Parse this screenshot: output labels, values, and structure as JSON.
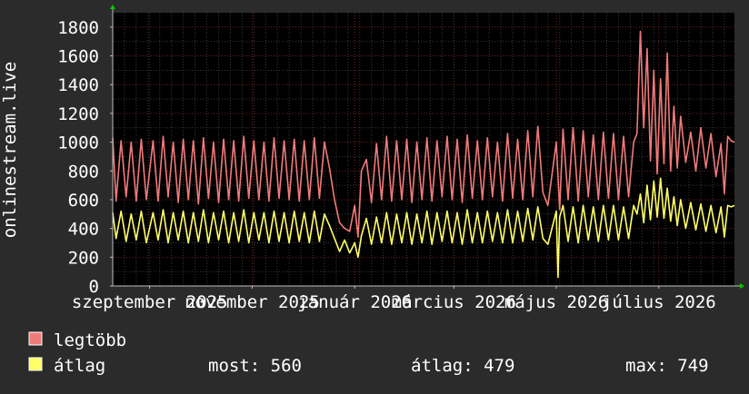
{
  "colors": {
    "background": "#2b2b2b",
    "plot_background": "#000000",
    "grid_minor": "#3a3a3a",
    "grid_major": "#6b2020",
    "axis": "#bfbfbf",
    "arrow": "#00cc00",
    "text": "#ffffff",
    "max_series": "#f07a7a",
    "avg_series": "#ffff66"
  },
  "chart_data": {
    "type": "line",
    "ylabel": "onlinestream.live",
    "ylim": [
      0,
      1900
    ],
    "yticks": [
      0,
      200,
      400,
      600,
      800,
      1000,
      1200,
      1400,
      1600,
      1800
    ],
    "xlim": [
      "2025-08-10",
      "2026-08-15"
    ],
    "xticks": [
      {
        "date": "2025-09-01",
        "label": "szeptember 2025"
      },
      {
        "date": "2025-11-01",
        "label": "november 2025"
      },
      {
        "date": "2026-01-01",
        "label": "január 2026"
      },
      {
        "date": "2026-03-01",
        "label": "március 2026"
      },
      {
        "date": "2026-05-01",
        "label": "május 2026"
      },
      {
        "date": "2026-07-01",
        "label": "július 2026"
      }
    ],
    "grid": true,
    "series": [
      {
        "name": "legtöbb",
        "color": "#f07a7a",
        "points": [
          [
            "2025-08-10",
            1030
          ],
          [
            "2025-08-12",
            590
          ],
          [
            "2025-08-15",
            1010
          ],
          [
            "2025-08-18",
            620
          ],
          [
            "2025-08-21",
            1000
          ],
          [
            "2025-08-24",
            590
          ],
          [
            "2025-08-27",
            1020
          ],
          [
            "2025-08-30",
            600
          ],
          [
            "2025-09-03",
            1010
          ],
          [
            "2025-09-06",
            590
          ],
          [
            "2025-09-09",
            1040
          ],
          [
            "2025-09-12",
            620
          ],
          [
            "2025-09-15",
            1000
          ],
          [
            "2025-09-18",
            580
          ],
          [
            "2025-09-21",
            1020
          ],
          [
            "2025-09-24",
            600
          ],
          [
            "2025-09-27",
            1010
          ],
          [
            "2025-09-30",
            570
          ],
          [
            "2025-10-03",
            1030
          ],
          [
            "2025-10-06",
            610
          ],
          [
            "2025-10-09",
            1000
          ],
          [
            "2025-10-12",
            580
          ],
          [
            "2025-10-15",
            1020
          ],
          [
            "2025-10-18",
            600
          ],
          [
            "2025-10-21",
            1010
          ],
          [
            "2025-10-24",
            590
          ],
          [
            "2025-10-27",
            1040
          ],
          [
            "2025-10-30",
            610
          ],
          [
            "2025-11-02",
            1010
          ],
          [
            "2025-11-05",
            600
          ],
          [
            "2025-11-08",
            1000
          ],
          [
            "2025-11-11",
            590
          ],
          [
            "2025-11-14",
            1030
          ],
          [
            "2025-11-17",
            610
          ],
          [
            "2025-11-20",
            1010
          ],
          [
            "2025-11-23",
            600
          ],
          [
            "2025-11-26",
            1020
          ],
          [
            "2025-11-29",
            590
          ],
          [
            "2025-12-02",
            1010
          ],
          [
            "2025-12-05",
            600
          ],
          [
            "2025-12-08",
            1030
          ],
          [
            "2025-12-11",
            610
          ],
          [
            "2025-12-14",
            1000
          ],
          [
            "2025-12-17",
            820
          ],
          [
            "2025-12-20",
            600
          ],
          [
            "2025-12-23",
            440
          ],
          [
            "2025-12-26",
            400
          ],
          [
            "2025-12-29",
            380
          ],
          [
            "2026-01-01",
            560
          ],
          [
            "2026-01-03",
            340
          ],
          [
            "2026-01-05",
            800
          ],
          [
            "2026-01-08",
            880
          ],
          [
            "2026-01-11",
            580
          ],
          [
            "2026-01-14",
            990
          ],
          [
            "2026-01-17",
            600
          ],
          [
            "2026-01-20",
            1040
          ],
          [
            "2026-01-23",
            590
          ],
          [
            "2026-01-26",
            1010
          ],
          [
            "2026-01-29",
            600
          ],
          [
            "2026-02-01",
            1020
          ],
          [
            "2026-02-04",
            580
          ],
          [
            "2026-02-07",
            1000
          ],
          [
            "2026-02-10",
            600
          ],
          [
            "2026-02-13",
            1030
          ],
          [
            "2026-02-16",
            590
          ],
          [
            "2026-02-19",
            1010
          ],
          [
            "2026-02-22",
            620
          ],
          [
            "2026-02-25",
            1040
          ],
          [
            "2026-02-28",
            600
          ],
          [
            "2026-03-03",
            1020
          ],
          [
            "2026-03-06",
            580
          ],
          [
            "2026-03-09",
            1050
          ],
          [
            "2026-03-12",
            610
          ],
          [
            "2026-03-15",
            1010
          ],
          [
            "2026-03-18",
            600
          ],
          [
            "2026-03-21",
            1030
          ],
          [
            "2026-03-24",
            620
          ],
          [
            "2026-03-27",
            1000
          ],
          [
            "2026-03-30",
            590
          ],
          [
            "2026-04-02",
            1060
          ],
          [
            "2026-04-05",
            610
          ],
          [
            "2026-04-08",
            1020
          ],
          [
            "2026-04-11",
            600
          ],
          [
            "2026-04-14",
            1080
          ],
          [
            "2026-04-17",
            620
          ],
          [
            "2026-04-20",
            1110
          ],
          [
            "2026-04-23",
            650
          ],
          [
            "2026-04-26",
            560
          ],
          [
            "2026-05-01",
            1000
          ],
          [
            "2026-05-03",
            530
          ],
          [
            "2026-05-05",
            1090
          ],
          [
            "2026-05-08",
            600
          ],
          [
            "2026-05-11",
            1100
          ],
          [
            "2026-05-14",
            590
          ],
          [
            "2026-05-17",
            1080
          ],
          [
            "2026-05-20",
            620
          ],
          [
            "2026-05-23",
            1050
          ],
          [
            "2026-05-26",
            600
          ],
          [
            "2026-05-29",
            1070
          ],
          [
            "2026-06-01",
            610
          ],
          [
            "2026-06-04",
            1060
          ],
          [
            "2026-06-07",
            600
          ],
          [
            "2026-06-10",
            1040
          ],
          [
            "2026-06-13",
            620
          ],
          [
            "2026-06-16",
            1000
          ],
          [
            "2026-06-18",
            1060
          ],
          [
            "2026-06-20",
            1770
          ],
          [
            "2026-06-22",
            1100
          ],
          [
            "2026-06-24",
            1650
          ],
          [
            "2026-06-26",
            870
          ],
          [
            "2026-06-28",
            1500
          ],
          [
            "2026-06-30",
            780
          ],
          [
            "2026-07-02",
            1440
          ],
          [
            "2026-07-04",
            850
          ],
          [
            "2026-07-06",
            1620
          ],
          [
            "2026-07-08",
            800
          ],
          [
            "2026-07-10",
            1250
          ],
          [
            "2026-07-12",
            820
          ],
          [
            "2026-07-14",
            1180
          ],
          [
            "2026-07-17",
            860
          ],
          [
            "2026-07-20",
            1070
          ],
          [
            "2026-07-23",
            800
          ],
          [
            "2026-07-26",
            1100
          ],
          [
            "2026-07-29",
            820
          ],
          [
            "2026-08-01",
            1060
          ],
          [
            "2026-08-04",
            760
          ],
          [
            "2026-08-07",
            990
          ],
          [
            "2026-08-09",
            640
          ],
          [
            "2026-08-11",
            1040
          ],
          [
            "2026-08-13",
            1010
          ],
          [
            "2026-08-15",
            1000
          ]
        ]
      },
      {
        "name": "átlag",
        "color": "#ffff66",
        "points": [
          [
            "2025-08-10",
            510
          ],
          [
            "2025-08-12",
            330
          ],
          [
            "2025-08-15",
            520
          ],
          [
            "2025-08-18",
            310
          ],
          [
            "2025-08-21",
            500
          ],
          [
            "2025-08-24",
            320
          ],
          [
            "2025-08-27",
            520
          ],
          [
            "2025-08-30",
            300
          ],
          [
            "2025-09-03",
            510
          ],
          [
            "2025-09-06",
            320
          ],
          [
            "2025-09-09",
            530
          ],
          [
            "2025-09-12",
            300
          ],
          [
            "2025-09-15",
            510
          ],
          [
            "2025-09-18",
            320
          ],
          [
            "2025-09-21",
            520
          ],
          [
            "2025-09-24",
            300
          ],
          [
            "2025-09-27",
            510
          ],
          [
            "2025-09-30",
            310
          ],
          [
            "2025-10-03",
            530
          ],
          [
            "2025-10-06",
            300
          ],
          [
            "2025-10-09",
            510
          ],
          [
            "2025-10-12",
            320
          ],
          [
            "2025-10-15",
            520
          ],
          [
            "2025-10-18",
            300
          ],
          [
            "2025-10-21",
            510
          ],
          [
            "2025-10-24",
            310
          ],
          [
            "2025-10-27",
            530
          ],
          [
            "2025-10-30",
            300
          ],
          [
            "2025-11-02",
            510
          ],
          [
            "2025-11-05",
            320
          ],
          [
            "2025-11-08",
            510
          ],
          [
            "2025-11-11",
            300
          ],
          [
            "2025-11-14",
            520
          ],
          [
            "2025-11-17",
            310
          ],
          [
            "2025-11-20",
            510
          ],
          [
            "2025-11-23",
            300
          ],
          [
            "2025-11-26",
            520
          ],
          [
            "2025-11-29",
            310
          ],
          [
            "2025-12-02",
            510
          ],
          [
            "2025-12-05",
            300
          ],
          [
            "2025-12-08",
            520
          ],
          [
            "2025-12-11",
            310
          ],
          [
            "2025-12-14",
            500
          ],
          [
            "2025-12-17",
            420
          ],
          [
            "2025-12-20",
            330
          ],
          [
            "2025-12-23",
            240
          ],
          [
            "2025-12-26",
            320
          ],
          [
            "2025-12-29",
            230
          ],
          [
            "2026-01-01",
            300
          ],
          [
            "2026-01-03",
            200
          ],
          [
            "2026-01-05",
            350
          ],
          [
            "2026-01-08",
            470
          ],
          [
            "2026-01-11",
            290
          ],
          [
            "2026-01-14",
            480
          ],
          [
            "2026-01-17",
            300
          ],
          [
            "2026-01-20",
            510
          ],
          [
            "2026-01-23",
            290
          ],
          [
            "2026-01-26",
            500
          ],
          [
            "2026-01-29",
            300
          ],
          [
            "2026-02-01",
            510
          ],
          [
            "2026-02-04",
            290
          ],
          [
            "2026-02-07",
            500
          ],
          [
            "2026-02-10",
            300
          ],
          [
            "2026-02-13",
            520
          ],
          [
            "2026-02-16",
            290
          ],
          [
            "2026-02-19",
            510
          ],
          [
            "2026-02-22",
            310
          ],
          [
            "2026-02-25",
            520
          ],
          [
            "2026-02-28",
            300
          ],
          [
            "2026-03-03",
            510
          ],
          [
            "2026-03-06",
            290
          ],
          [
            "2026-03-09",
            530
          ],
          [
            "2026-03-12",
            300
          ],
          [
            "2026-03-15",
            510
          ],
          [
            "2026-03-18",
            300
          ],
          [
            "2026-03-21",
            520
          ],
          [
            "2026-03-24",
            310
          ],
          [
            "2026-03-27",
            510
          ],
          [
            "2026-03-30",
            300
          ],
          [
            "2026-04-02",
            530
          ],
          [
            "2026-04-05",
            300
          ],
          [
            "2026-04-08",
            520
          ],
          [
            "2026-04-11",
            310
          ],
          [
            "2026-04-14",
            540
          ],
          [
            "2026-04-17",
            320
          ],
          [
            "2026-04-20",
            550
          ],
          [
            "2026-04-23",
            330
          ],
          [
            "2026-04-26",
            290
          ],
          [
            "2026-05-01",
            520
          ],
          [
            "2026-05-02",
            60
          ],
          [
            "2026-05-03",
            480
          ],
          [
            "2026-05-05",
            560
          ],
          [
            "2026-05-08",
            310
          ],
          [
            "2026-05-11",
            550
          ],
          [
            "2026-05-14",
            300
          ],
          [
            "2026-05-17",
            560
          ],
          [
            "2026-05-20",
            320
          ],
          [
            "2026-05-23",
            550
          ],
          [
            "2026-05-26",
            310
          ],
          [
            "2026-05-29",
            560
          ],
          [
            "2026-06-01",
            320
          ],
          [
            "2026-06-04",
            560
          ],
          [
            "2026-06-07",
            320
          ],
          [
            "2026-06-10",
            550
          ],
          [
            "2026-06-13",
            330
          ],
          [
            "2026-06-16",
            560
          ],
          [
            "2026-06-18",
            500
          ],
          [
            "2026-06-20",
            640
          ],
          [
            "2026-06-22",
            440
          ],
          [
            "2026-06-24",
            700
          ],
          [
            "2026-06-26",
            460
          ],
          [
            "2026-06-28",
            730
          ],
          [
            "2026-06-30",
            480
          ],
          [
            "2026-07-02",
            749
          ],
          [
            "2026-07-04",
            470
          ],
          [
            "2026-07-06",
            680
          ],
          [
            "2026-07-08",
            450
          ],
          [
            "2026-07-10",
            620
          ],
          [
            "2026-07-12",
            420
          ],
          [
            "2026-07-14",
            600
          ],
          [
            "2026-07-17",
            400
          ],
          [
            "2026-07-20",
            580
          ],
          [
            "2026-07-23",
            390
          ],
          [
            "2026-07-26",
            570
          ],
          [
            "2026-07-29",
            380
          ],
          [
            "2026-08-01",
            560
          ],
          [
            "2026-08-04",
            370
          ],
          [
            "2026-08-07",
            550
          ],
          [
            "2026-08-09",
            340
          ],
          [
            "2026-08-11",
            560
          ],
          [
            "2026-08-13",
            550
          ],
          [
            "2026-08-15",
            560
          ]
        ]
      }
    ],
    "legend": {
      "position": "bottom-left",
      "entries": [
        {
          "label": "legtöbb",
          "color": "#f07a7a"
        },
        {
          "label": "átlag",
          "color": "#ffff66"
        }
      ]
    },
    "stats": {
      "now": "most: 560",
      "avg": "átlag: 479",
      "max": "max: 749"
    }
  }
}
